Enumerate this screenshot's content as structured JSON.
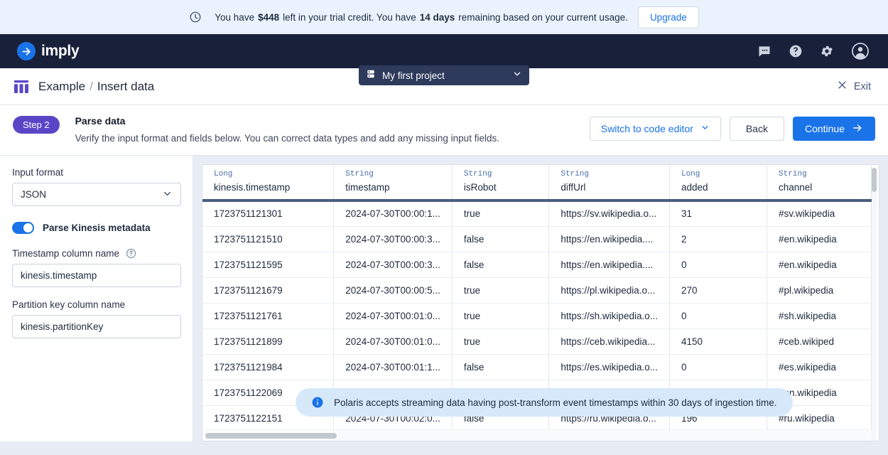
{
  "trial_banner": {
    "icon": "clock-icon",
    "text_before": "You have ",
    "amount": "$448",
    "text_middle": " left in your trial credit. You have ",
    "days": "14 days",
    "text_after": " remaining based on your current usage.",
    "upgrade_label": "Upgrade"
  },
  "topnav": {
    "brand": "imply",
    "brand_icon": "arrow-right-circle-icon",
    "project_icon": "server-icon",
    "project_name": "My first project",
    "chevron_icon": "chevron-down-icon",
    "icons": [
      "chat-bubble-icon",
      "help-circle-icon",
      "gear-icon",
      "user-avatar-icon"
    ]
  },
  "breadcrumb": {
    "icon": "table-columns-icon",
    "parent": "Example",
    "separator": "/",
    "current": "Insert data",
    "exit_label": "Exit",
    "exit_icon": "close-icon"
  },
  "step": {
    "badge": "Step 2",
    "title": "Parse data",
    "description": "Verify the input format and fields below. You can correct data types and add any missing input fields.",
    "switch_editor_label": "Switch to code editor",
    "back_label": "Back",
    "continue_label": "Continue",
    "continue_icon": "arrow-right-icon"
  },
  "sidebar": {
    "input_format_label": "Input format",
    "input_format_value": "JSON",
    "input_format_options": [
      "JSON"
    ],
    "toggle_label": "Parse Kinesis metadata",
    "toggle_on": true,
    "timestamp_label": "Timestamp column name",
    "timestamp_help_icon": "help-circle-icon",
    "timestamp_value": "kinesis.timestamp",
    "partition_label": "Partition key column name",
    "partition_value": "kinesis.partitionKey"
  },
  "table": {
    "columns": [
      {
        "type": "Long",
        "name": "kinesis.timestamp"
      },
      {
        "type": "String",
        "name": "timestamp"
      },
      {
        "type": "String",
        "name": "isRobot"
      },
      {
        "type": "String",
        "name": "diffUrl"
      },
      {
        "type": "Long",
        "name": "added"
      },
      {
        "type": "String",
        "name": "channel"
      }
    ],
    "rows": [
      [
        "1723751121301",
        "2024-07-30T00:00:1...",
        "true",
        "https://sv.wikipedia.o...",
        "31",
        "#sv.wikipedia"
      ],
      [
        "1723751121510",
        "2024-07-30T00:00:3...",
        "false",
        "https://en.wikipedia....",
        "2",
        "#en.wikipedia"
      ],
      [
        "1723751121595",
        "2024-07-30T00:00:3...",
        "false",
        "https://en.wikipedia....",
        "0",
        "#en.wikipedia"
      ],
      [
        "1723751121679",
        "2024-07-30T00:00:5...",
        "true",
        "https://pl.wikipedia.o...",
        "270",
        "#pl.wikipedia"
      ],
      [
        "1723751121761",
        "2024-07-30T00:01:0...",
        "true",
        "https://sh.wikipedia.o...",
        "0",
        "#sh.wikipedia"
      ],
      [
        "1723751121899",
        "2024-07-30T00:01:0...",
        "true",
        "https://ceb.wikipedia...",
        "4150",
        "#ceb.wikiped"
      ],
      [
        "1723751121984",
        "2024-07-30T00:01:1...",
        "false",
        "https://es.wikipedia.o...",
        "0",
        "#es.wikipedia"
      ],
      [
        "1723751122069",
        "",
        "",
        "",
        "",
        "#en.wikipedia"
      ],
      [
        "1723751122151",
        "2024-07-30T00:02:0...",
        "false",
        "https://ru.wikipedia.o...",
        "196",
        "#ru.wikipedia"
      ]
    ]
  },
  "toast": {
    "icon": "info-icon",
    "message": "Polaris accepts streaming data having post-transform event timestamps within 30 days of ingestion time."
  },
  "colors": {
    "brand_blue": "#1a73e8",
    "nav_dark": "#19203a",
    "step_purple": "#5b45c7",
    "banner_blue": "#eaf3fd",
    "toast_blue": "#d6e9fb",
    "header_rule": "#4a5c80"
  }
}
